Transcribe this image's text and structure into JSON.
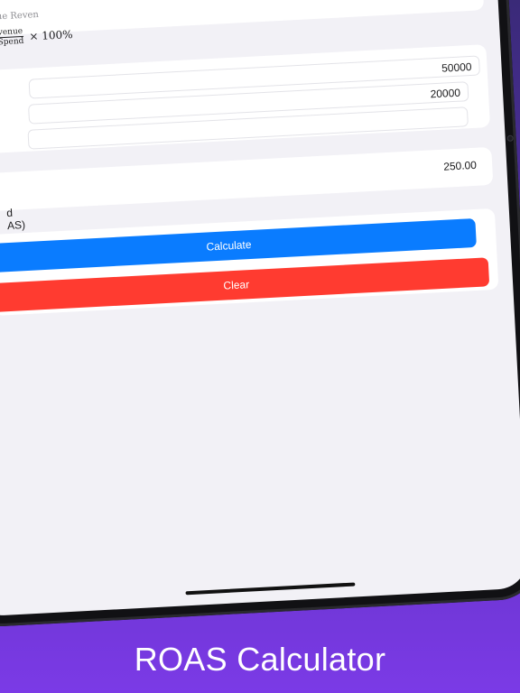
{
  "formula": {
    "top_text": "ue Reven",
    "numerator": "venue",
    "denominator": "Spend",
    "multiplier": "× 100%"
  },
  "inputs": {
    "revenue_value": "50000",
    "spend_value": "20000",
    "third_value": ""
  },
  "result": {
    "value": "250.00",
    "label_line1": "d",
    "label_line2": "AS)"
  },
  "buttons": {
    "calculate_label": "Calculate",
    "clear_label": "Clear"
  },
  "caption": "ROAS Calculator",
  "colors": {
    "calculate": "#0a7cff",
    "clear": "#ff3b30",
    "background_top": "#3a2a78",
    "background_bottom": "#7b3ae6"
  }
}
